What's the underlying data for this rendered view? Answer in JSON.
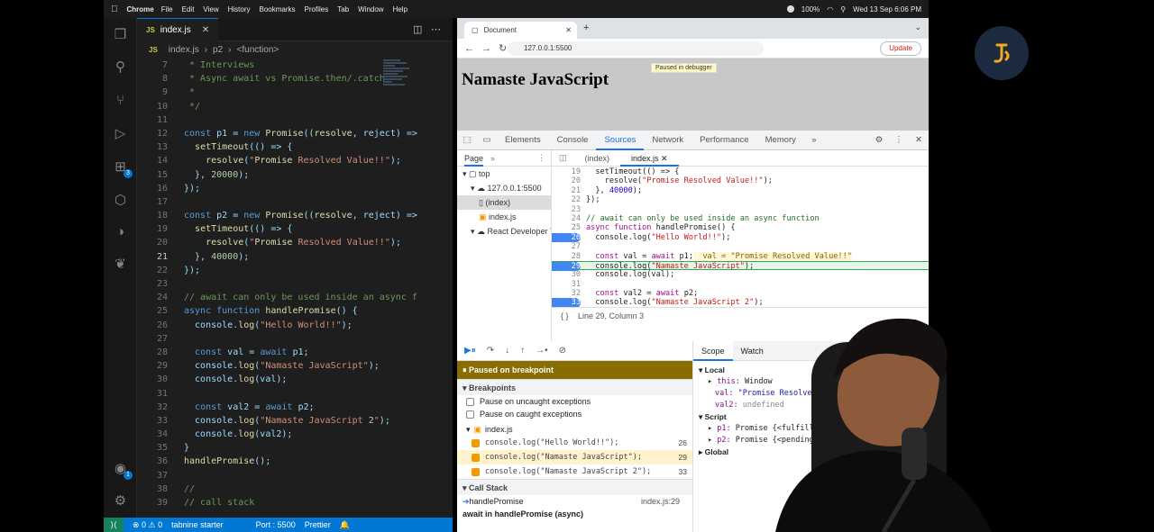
{
  "menubar": {
    "app": "Chrome",
    "items": [
      "File",
      "Edit",
      "View",
      "History",
      "Bookmarks",
      "Profiles",
      "Tab",
      "Window",
      "Help"
    ],
    "battery": "100%",
    "datetime": "Wed 13 Sep  6:06 PM"
  },
  "vscode": {
    "tab_label": "index.js",
    "breadcrumb": {
      "file": "index.js",
      "sym1": "p2",
      "sym2": "<function>"
    },
    "activity_badges": {
      "extensions": "3",
      "accounts": "1"
    },
    "code_lines": [
      {
        "n": "7",
        "t": " * Interviews",
        "k": "cm"
      },
      {
        "n": "8",
        "t": " * Async await vs Promise.then/.catch",
        "k": "cm"
      },
      {
        "n": "9",
        "t": " *",
        "k": "cm"
      },
      {
        "n": "10",
        "t": " */",
        "k": "cm"
      },
      {
        "n": "11",
        "t": "",
        "k": ""
      },
      {
        "n": "12",
        "t": "const p1 = new Promise((resolve, reject) =>",
        "k": "code"
      },
      {
        "n": "13",
        "t": "  setTimeout(() => {",
        "k": "code"
      },
      {
        "n": "14",
        "t": "    resolve(\"Promise Resolved Value!!\");",
        "k": "code"
      },
      {
        "n": "15",
        "t": "  }, 20000);",
        "k": "code"
      },
      {
        "n": "16",
        "t": "});",
        "k": "code"
      },
      {
        "n": "17",
        "t": "",
        "k": ""
      },
      {
        "n": "18",
        "t": "const p2 = new Promise((resolve, reject) =>",
        "k": "code"
      },
      {
        "n": "19",
        "t": "  setTimeout(() => {",
        "k": "code"
      },
      {
        "n": "20",
        "t": "    resolve(\"Promise Resolved Value!!\");",
        "k": "code"
      },
      {
        "n": "21",
        "t": "  }, 40000);",
        "k": "code"
      },
      {
        "n": "22",
        "t": "});",
        "k": "code"
      },
      {
        "n": "23",
        "t": "",
        "k": ""
      },
      {
        "n": "24",
        "t": "// await can only be used inside an async f",
        "k": "cm"
      },
      {
        "n": "25",
        "t": "async function handlePromise() {",
        "k": "code"
      },
      {
        "n": "26",
        "t": "  console.log(\"Hello World!!\");",
        "k": "code"
      },
      {
        "n": "27",
        "t": "",
        "k": ""
      },
      {
        "n": "28",
        "t": "  const val = await p1;",
        "k": "code"
      },
      {
        "n": "29",
        "t": "  console.log(\"Namaste JavaScript\");",
        "k": "code"
      },
      {
        "n": "30",
        "t": "  console.log(val);",
        "k": "code"
      },
      {
        "n": "31",
        "t": "",
        "k": ""
      },
      {
        "n": "32",
        "t": "  const val2 = await p2;",
        "k": "code"
      },
      {
        "n": "33",
        "t": "  console.log(\"Namaste JavaScript 2\");",
        "k": "code"
      },
      {
        "n": "34",
        "t": "  console.log(val2);",
        "k": "code"
      },
      {
        "n": "35",
        "t": "}",
        "k": "code"
      },
      {
        "n": "36",
        "t": "handlePromise();",
        "k": "code"
      },
      {
        "n": "37",
        "t": "",
        "k": ""
      },
      {
        "n": "38",
        "t": "//",
        "k": "cm"
      },
      {
        "n": "39",
        "t": "// call stack",
        "k": "cm"
      }
    ],
    "current_line": "21",
    "status": {
      "problems": "⊗ 0 ⚠ 0",
      "tabnine": "tabnine starter",
      "port": "Port : 5500",
      "prettier": "Prettier"
    }
  },
  "browser": {
    "tab_title": "Document",
    "url": "127.0.0.1:5500",
    "update_label": "Update",
    "page_heading": "Namaste JavaScript",
    "paused_badge": "Paused in debugger"
  },
  "devtools": {
    "tabs": [
      "Elements",
      "Console",
      "Sources",
      "Network",
      "Performance",
      "Memory"
    ],
    "active_tab": "Sources",
    "navigator": {
      "tab": "Page",
      "tree": [
        {
          "label": "top",
          "indent": 0,
          "icon": "frame"
        },
        {
          "label": "127.0.0.1:5500",
          "indent": 1,
          "icon": "cloud"
        },
        {
          "label": "(index)",
          "indent": 2,
          "icon": "file",
          "selected": true
        },
        {
          "label": "index.js",
          "indent": 2,
          "icon": "jsfile"
        },
        {
          "label": "React Developer Tools",
          "indent": 1,
          "icon": "cloud"
        }
      ]
    },
    "source_tabs": [
      "(index)",
      "index.js"
    ],
    "source_lines": [
      {
        "n": "19",
        "t": "  setTimeout(() => {"
      },
      {
        "n": "20",
        "t": "    resolve(\"Promise Resolved Value!!\");"
      },
      {
        "n": "21",
        "t": "  }, 40000);"
      },
      {
        "n": "22",
        "t": "});"
      },
      {
        "n": "23",
        "t": ""
      },
      {
        "n": "24",
        "t": "// await can only be used inside an async function"
      },
      {
        "n": "25",
        "t": "async function handlePromise() {"
      },
      {
        "n": "26",
        "t": "  console.log(\"Hello World!!\");",
        "bp": true
      },
      {
        "n": "27",
        "t": ""
      },
      {
        "n": "28",
        "t": "  const val = await p1;",
        "inline": "val = \"Promise Resolved Value!!\""
      },
      {
        "n": "29",
        "t": "  console.log(\"Namaste JavaScript\");",
        "bp": true,
        "paused": true
      },
      {
        "n": "30",
        "t": "  console.log(val);"
      },
      {
        "n": "31",
        "t": ""
      },
      {
        "n": "32",
        "t": "  const val2 = await p2;"
      },
      {
        "n": "33",
        "t": "  console.log(\"Namaste JavaScript 2\");",
        "bp": true
      },
      {
        "n": "34",
        "t": "  console.log(val2);"
      }
    ],
    "position": "Line 29, Column 3",
    "paused_label": "Paused on breakpoint",
    "breakpoints_label": "Breakpoints",
    "uncaught": "Pause on uncaught exceptions",
    "caught": "Pause on caught exceptions",
    "bp_file": "index.js",
    "bp_list": [
      {
        "code": "console.log(\"Hello World!!\");",
        "line": "26"
      },
      {
        "code": "console.log(\"Namaste JavaScript\");",
        "line": "29",
        "hl": true
      },
      {
        "code": "console.log(\"Namaste JavaScript 2\");",
        "line": "33"
      }
    ],
    "callstack_label": "Call Stack",
    "callstack": [
      {
        "fn": "handlePromise",
        "loc": "index.js:29"
      },
      {
        "fn": "await in handlePromise (async)",
        "loc": ""
      }
    ],
    "scope_tabs": [
      "Scope",
      "Watch"
    ],
    "scope": {
      "local": "Local",
      "this_key": "this:",
      "this_val": "Window",
      "val_key": "val:",
      "val_val": "\"Promise Resolved Value!!\"",
      "val2_key": "val2:",
      "val2_val": "undefined",
      "script": "Script",
      "p1_key": "p1:",
      "p1_val": "Promise {<fulfilled>",
      "p2_key": "p2:",
      "p2_val": "Promise {<pending>",
      "global": "Global"
    }
  }
}
